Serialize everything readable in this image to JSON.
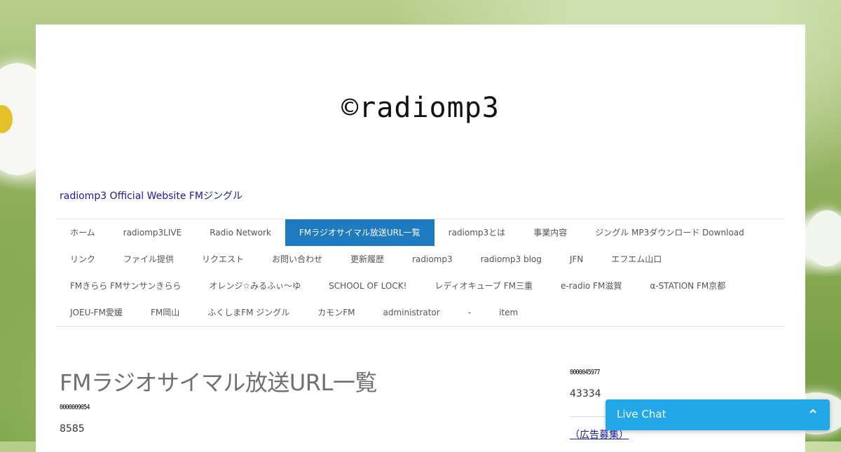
{
  "header": {
    "logo_text": "©radiomp3",
    "tagline": "radiomp3 Official Website FMジングル"
  },
  "nav": {
    "items": [
      {
        "label": "ホーム"
      },
      {
        "label": "radiomp3LIVE"
      },
      {
        "label": "Radio Network"
      },
      {
        "label": "FMラジオサイマル放送URL一覧",
        "active": true
      },
      {
        "label": "radiomp3とは"
      },
      {
        "label": "事業内容"
      },
      {
        "label": "ジングル MP3ダウンロード Download"
      },
      {
        "label": "リンク"
      },
      {
        "label": "ファイル提供"
      },
      {
        "label": "リクエスト"
      },
      {
        "label": "お問い合わせ"
      },
      {
        "label": "更新履歴"
      },
      {
        "label": "radiomp3"
      },
      {
        "label": "radiomp3 blog"
      },
      {
        "label": "JFN"
      },
      {
        "label": "エフエム山口"
      },
      {
        "label": "FMきらら FMサンサンきらら"
      },
      {
        "label": "オレンジ☆みるふぃ～ゆ"
      },
      {
        "label": "SCHOOL OF LOCK!"
      },
      {
        "label": "レディオキューブ FM三重"
      },
      {
        "label": "e-radio FM滋賀"
      },
      {
        "label": "α-STATION FM京都"
      },
      {
        "label": "JOEU-FM愛媛"
      },
      {
        "label": "FM岡山"
      },
      {
        "label": "ふくしまFM ジングル"
      },
      {
        "label": "カモンFM"
      },
      {
        "label": "administrator"
      },
      {
        "label": "-"
      },
      {
        "label": "item"
      }
    ]
  },
  "main": {
    "title": "FMラジオサイマル放送URL一覧",
    "counter_image_text": "0000009054",
    "count": "8585"
  },
  "sidebar": {
    "counter_image_text": "0000045977",
    "count": "43334",
    "ad_link": "（広告募集）"
  },
  "chat": {
    "label": "Live Chat",
    "toggle_icon": "chevron-up-icon"
  },
  "colors": {
    "nav_active_bg": "#1f7bbf",
    "chat_bg": "#22a7e8",
    "link": "#1a1aa6"
  }
}
